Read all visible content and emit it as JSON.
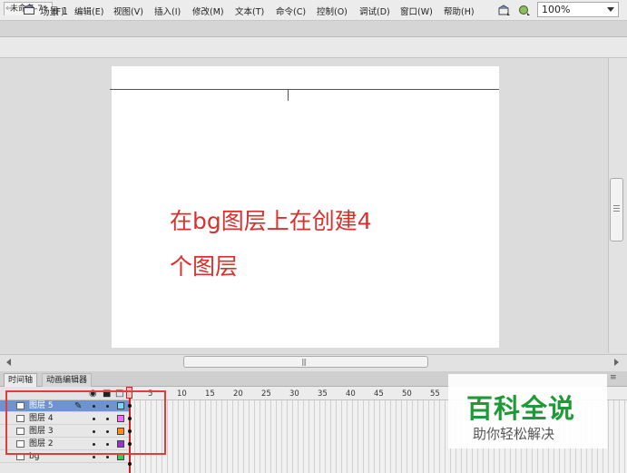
{
  "app": {
    "logo": "Fl"
  },
  "menu": [
    "文件(F)",
    "编辑(E)",
    "视图(V)",
    "插入(I)",
    "修改(M)",
    "文本(T)",
    "命令(C)",
    "控制(O)",
    "调试(D)",
    "窗口(W)",
    "帮助(H)"
  ],
  "document_tab": {
    "label": "未命名-7*"
  },
  "edit_bar": {
    "scene_label": "场景 1",
    "zoom": "100%"
  },
  "stage": {
    "annotation_line1": "在bg图层上在创建4",
    "annotation_line2": "个图层",
    "annotation_color": "#d9302c"
  },
  "panel_tabs": {
    "timeline": "时间轴",
    "motion_editor": "动画编辑器"
  },
  "timeline": {
    "frame_numbers": [
      "5",
      "10",
      "15",
      "20",
      "25",
      "30",
      "35",
      "40",
      "45",
      "50",
      "55"
    ],
    "layers": [
      {
        "name": "图层 5",
        "color": "#7fd7ff",
        "selected": true
      },
      {
        "name": "图层 4",
        "color": "#ff66ff",
        "selected": false
      },
      {
        "name": "图层 3",
        "color": "#ff8a1f",
        "selected": false
      },
      {
        "name": "图层 2",
        "color": "#9b2fd6",
        "selected": false
      },
      {
        "name": "bg",
        "color": "#33cc55",
        "selected": false
      }
    ]
  },
  "watermark": {
    "title": "百科全说",
    "subtitle": "助你轻松解决",
    "color": "#1e9a36"
  }
}
